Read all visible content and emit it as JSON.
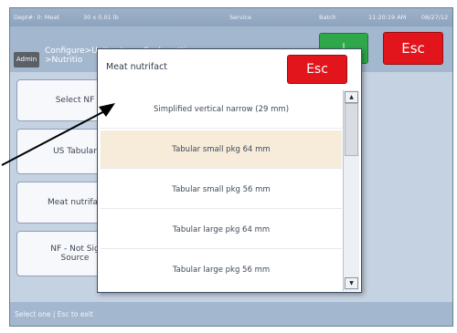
{
  "status_bar": {
    "dept": "Dept#: 0: Meat",
    "weight": "30 x 0.01 lb",
    "mode": "Service",
    "batch": "Batch",
    "time": "11:20:19 AM",
    "date": "08/27/12"
  },
  "title_bar": {
    "user": "Admin",
    "breadcrumb_line1": "Configure>Unit setup->Scale settings-",
    "breadcrumb_line2": ">Nutritio",
    "green_button_label": "↓",
    "esc_label": "Esc"
  },
  "side_menu": [
    {
      "label": "Select NF"
    },
    {
      "label": "US Tabular"
    },
    {
      "label": "Meat nutrifac"
    },
    {
      "label": "NF - Not Sig\nSource"
    }
  ],
  "footer": {
    "hint": "Select one | Esc to exit"
  },
  "dialog": {
    "title": "Meat nutrifact",
    "esc_label": "Esc",
    "options": [
      {
        "label": "Simplified vertical narrow (29 mm)",
        "selected": false
      },
      {
        "label": "Tabular small pkg 64 mm",
        "selected": true
      },
      {
        "label": "Tabular small pkg 56 mm",
        "selected": false
      },
      {
        "label": "Tabular large pkg 64 mm",
        "selected": false
      },
      {
        "label": "Tabular large pkg 56 mm",
        "selected": false
      }
    ],
    "scroll_up_glyph": "▲",
    "scroll_down_glyph": "▼"
  },
  "colors": {
    "esc_red": "#e2151d",
    "confirm_green": "#2fa84a",
    "selected_row": "#f6ecd9",
    "frame_blue": "#a3b7cf"
  }
}
